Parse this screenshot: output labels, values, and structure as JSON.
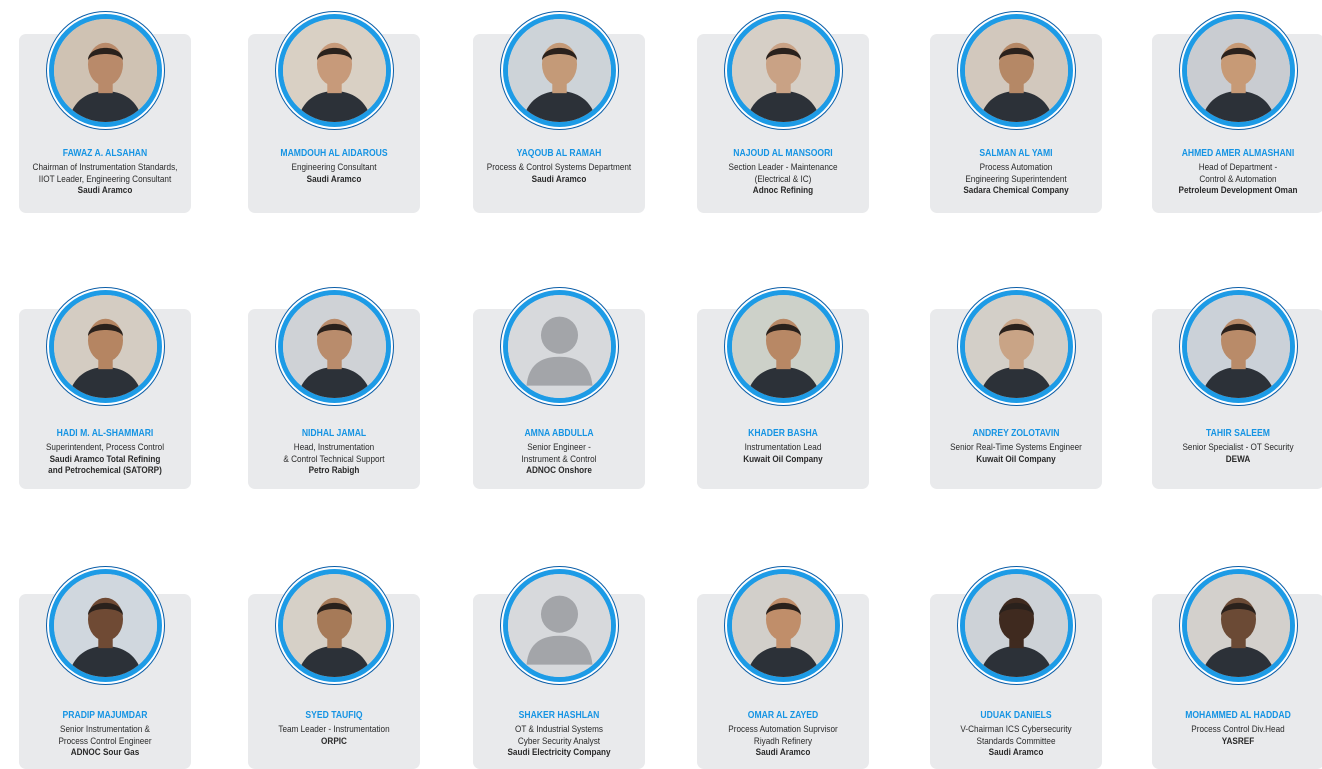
{
  "colors": {
    "accent": "#1694e3",
    "ring": "#1d9be6",
    "card": "#e9eaec"
  },
  "speakers": [
    {
      "name": "FAWAZ A. ALSAHAN",
      "role": "Chairman of Instrumentation Standards,\nIIOT Leader, Engineering Consultant",
      "org": "Saudi Aramco",
      "photo": "photo"
    },
    {
      "name": "MAMDOUH AL AIDAROUS",
      "role": "Engineering Consultant",
      "org": "Saudi Aramco",
      "photo": "photo"
    },
    {
      "name": "YAQOUB AL RAMAH",
      "role": "Process & Control Systems Department",
      "org": "Saudi Aramco",
      "photo": "photo"
    },
    {
      "name": "NAJOUD AL MANSOORI",
      "role": "Section Leader - Maintenance\n(Electrical & IC)",
      "org": "Adnoc Refining",
      "photo": "photo"
    },
    {
      "name": "SALMAN AL YAMI",
      "role": "Process Automation\nEngineering Superintendent",
      "org": "Sadara Chemical Company",
      "photo": "photo"
    },
    {
      "name": "AHMED AMER ALMASHANI",
      "role": "Head of Department -\nControl & Automation",
      "org": "Petroleum Development Oman",
      "photo": "photo"
    },
    {
      "name": "HADI M. AL-SHAMMARI",
      "role": "Superintendent, Process Control",
      "org": "Saudi Aramco Total Refining\nand Petrochemical (SATORP)",
      "photo": "photo"
    },
    {
      "name": "NIDHAL JAMAL",
      "role": "Head, Instrumentation\n& Control Technical Support",
      "org": "Petro Rabigh",
      "photo": "photo"
    },
    {
      "name": "AMNA ABDULLA",
      "role": "Senior Engineer -\nInstrument & Control",
      "org": "ADNOC Onshore",
      "photo": "placeholder-avatar-icon"
    },
    {
      "name": "KHADER BASHA",
      "role": "Instrumentation Lead",
      "org": "Kuwait Oil Company",
      "photo": "photo"
    },
    {
      "name": "ANDREY ZOLOTAVIN",
      "role": "Senior Real-Time Systems Engineer",
      "org": "Kuwait Oil Company",
      "photo": "photo"
    },
    {
      "name": "TAHIR SALEEM",
      "role": "Senior Specialist - OT Security",
      "org": "DEWA",
      "photo": "photo"
    },
    {
      "name": "PRADIP MAJUMDAR",
      "role": "Senior Instrumentation &\nProcess Control Engineer",
      "org": "ADNOC Sour Gas",
      "photo": "photo"
    },
    {
      "name": "SYED TAUFIQ",
      "role": "Team Leader - Instrumentation",
      "org": "ORPIC",
      "photo": "photo"
    },
    {
      "name": "SHAKER HASHLAN",
      "role": "OT & Industrial Systems\nCyber Security Analyst",
      "org": "Saudi Electricity Company",
      "photo": "placeholder-avatar-icon"
    },
    {
      "name": "OMAR AL ZAYED",
      "role": "Process Automation Suprvisor\nRiyadh Refinery",
      "org": "Saudi Aramco",
      "photo": "photo"
    },
    {
      "name": "UDUAK DANIELS",
      "role": "V-Chairman ICS Cybersecurity\nStandards Committee",
      "org": "Saudi Aramco",
      "photo": "photo"
    },
    {
      "name": "MOHAMMED AL HADDAD",
      "role": "Process Control Div.Head",
      "org": "YASREF",
      "photo": "photo"
    }
  ]
}
